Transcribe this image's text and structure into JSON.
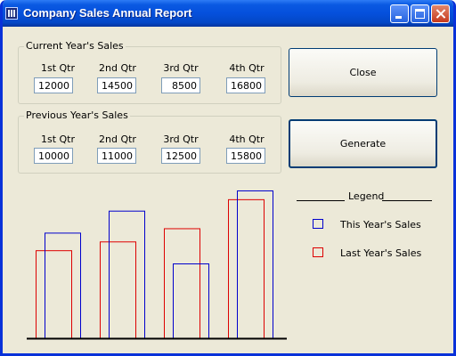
{
  "window": {
    "title": "Company Sales Annual Report"
  },
  "current_sales": {
    "title": "Current Year's Sales",
    "quarters": [
      {
        "label": "1st Qtr",
        "value": "12000"
      },
      {
        "label": "2nd Qtr",
        "value": "14500"
      },
      {
        "label": "3rd Qtr",
        "value": "8500"
      },
      {
        "label": "4th Qtr",
        "value": "16800"
      }
    ]
  },
  "previous_sales": {
    "title": "Previous Year's Sales",
    "quarters": [
      {
        "label": "1st Qtr",
        "value": "10000"
      },
      {
        "label": "2nd Qtr",
        "value": "11000"
      },
      {
        "label": "3rd Qtr",
        "value": "12500"
      },
      {
        "label": "4th Qtr",
        "value": "15800"
      }
    ]
  },
  "buttons": {
    "close": "Close",
    "generate": "Generate"
  },
  "legend": {
    "title": "Legend",
    "this_year": "This Year's Sales",
    "last_year": "Last Year's Sales"
  },
  "colors": {
    "this_year": "#0000cc",
    "last_year": "#dd0000",
    "axis": "#000000"
  },
  "chart_data": {
    "type": "bar",
    "title": "",
    "categories": [
      "1st Qtr",
      "2nd Qtr",
      "3rd Qtr",
      "4th Qtr"
    ],
    "series": [
      {
        "name": "This Year's Sales",
        "values": [
          12000,
          14500,
          8500,
          16800
        ]
      },
      {
        "name": "Last Year's Sales",
        "values": [
          10000,
          11000,
          12500,
          15800
        ]
      }
    ],
    "ylim": [
      0,
      17000
    ],
    "grid": false,
    "legend_position": "right"
  }
}
